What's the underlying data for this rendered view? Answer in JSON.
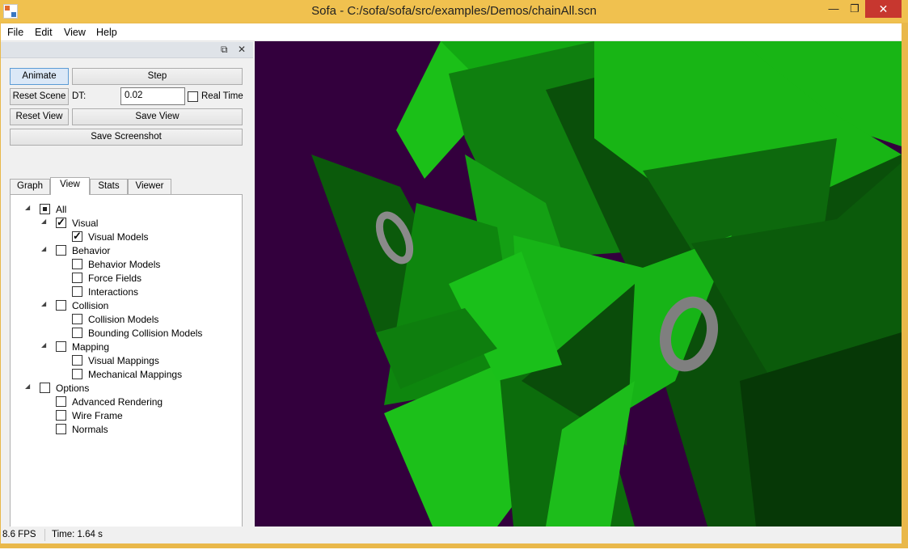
{
  "window": {
    "title": "Sofa - C:/sofa/sofa/src/examples/Demos/chainAll.scn",
    "controls": {
      "minimize": "—",
      "maximize": "❐",
      "close": "✕"
    }
  },
  "menu": [
    "File",
    "Edit",
    "View",
    "Help"
  ],
  "dock": {
    "float_icon": "⧉",
    "close_icon": "✕"
  },
  "controls": {
    "animate": "Animate",
    "step": "Step",
    "reset_scene": "Reset Scene",
    "dt_label": "DT:",
    "dt_value": "0.02",
    "real_time": "Real Time",
    "real_time_checked": false,
    "reset_view": "Reset View",
    "save_view": "Save View",
    "save_screenshot": "Save Screenshot"
  },
  "tabs": [
    {
      "label": "Graph",
      "selected": false
    },
    {
      "label": "View",
      "selected": true
    },
    {
      "label": "Stats",
      "selected": false
    },
    {
      "label": "Viewer",
      "selected": false
    }
  ],
  "tree": [
    {
      "label": "All",
      "state": "partial",
      "level": 0,
      "expandable": true
    },
    {
      "label": "Visual",
      "state": "checked",
      "level": 1,
      "expandable": true
    },
    {
      "label": "Visual Models",
      "state": "checked",
      "level": 2,
      "expandable": false
    },
    {
      "label": "Behavior",
      "state": "unchecked",
      "level": 1,
      "expandable": true
    },
    {
      "label": "Behavior Models",
      "state": "unchecked",
      "level": 2,
      "expandable": false
    },
    {
      "label": "Force Fields",
      "state": "unchecked",
      "level": 2,
      "expandable": false
    },
    {
      "label": "Interactions",
      "state": "unchecked",
      "level": 2,
      "expandable": false
    },
    {
      "label": "Collision",
      "state": "unchecked",
      "level": 1,
      "expandable": true
    },
    {
      "label": "Collision Models",
      "state": "unchecked",
      "level": 2,
      "expandable": false
    },
    {
      "label": "Bounding Collision Models",
      "state": "unchecked",
      "level": 2,
      "expandable": false
    },
    {
      "label": "Mapping",
      "state": "unchecked",
      "level": 1,
      "expandable": true
    },
    {
      "label": "Visual Mappings",
      "state": "unchecked",
      "level": 2,
      "expandable": false
    },
    {
      "label": "Mechanical Mappings",
      "state": "unchecked",
      "level": 2,
      "expandable": false
    },
    {
      "label": "Options",
      "state": "unchecked",
      "level": 0,
      "expandable": true
    },
    {
      "label": "Advanced Rendering",
      "state": "unchecked",
      "level": 1,
      "expandable": false
    },
    {
      "label": "Wire Frame",
      "state": "unchecked",
      "level": 1,
      "expandable": false
    },
    {
      "label": "Normals",
      "state": "unchecked",
      "level": 1,
      "expandable": false
    }
  ],
  "status": {
    "fps": "8.6 FPS",
    "time": "Time: 1.64 s"
  },
  "colors": {
    "titlebar": "#f0c14f",
    "viewport_background": "#33003d",
    "mesh_green": "#22c21f",
    "torus_gray": "#8a8a8a"
  }
}
